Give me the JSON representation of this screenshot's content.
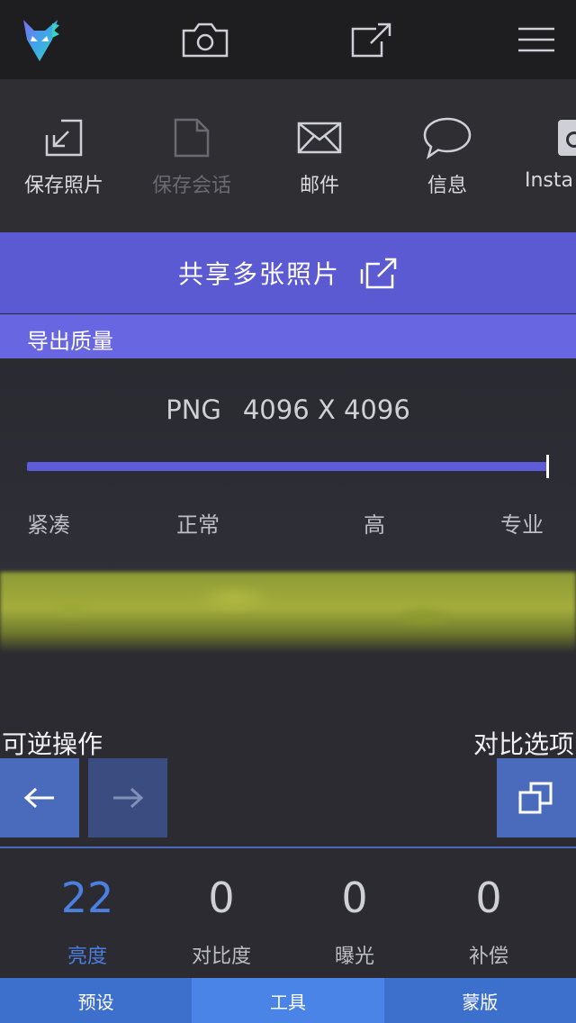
{
  "topbar": {
    "icons": [
      "fox-logo-icon",
      "camera-icon",
      "share-icon",
      "menu-icon"
    ]
  },
  "share_options": [
    {
      "label": "保存照片",
      "icon": "save-photo-icon",
      "enabled": true
    },
    {
      "label": "保存会话",
      "icon": "save-session-icon",
      "enabled": false
    },
    {
      "label": "邮件",
      "icon": "mail-icon",
      "enabled": true
    },
    {
      "label": "信息",
      "icon": "message-icon",
      "enabled": true
    },
    {
      "label": "Insta",
      "icon": "instagram-icon",
      "enabled": true
    }
  ],
  "share_multiple": {
    "label": "共享多张照片"
  },
  "export_quality": {
    "title": "导出质量",
    "format": "PNG",
    "resolution": "4096 X 4096",
    "slider_value_fraction": 1.0,
    "levels": [
      "紧凑",
      "正常",
      "高",
      "专业"
    ]
  },
  "undo_section": {
    "label": "可逆操作"
  },
  "compare_section": {
    "label": "对比选项"
  },
  "adjustments": [
    {
      "value": "22",
      "name": "亮度",
      "active": true
    },
    {
      "value": "0",
      "name": "对比度",
      "active": false
    },
    {
      "value": "0",
      "name": "曝光",
      "active": false
    },
    {
      "value": "0",
      "name": "补偿",
      "active": false
    }
  ],
  "tabs": [
    {
      "label": "预设",
      "active": false
    },
    {
      "label": "工具",
      "active": true
    },
    {
      "label": "蒙版",
      "active": false
    }
  ],
  "colors": {
    "accent": "#5c5ad2",
    "active_blue": "#4b7fe0",
    "tab_blue": "#3d6fcc"
  }
}
